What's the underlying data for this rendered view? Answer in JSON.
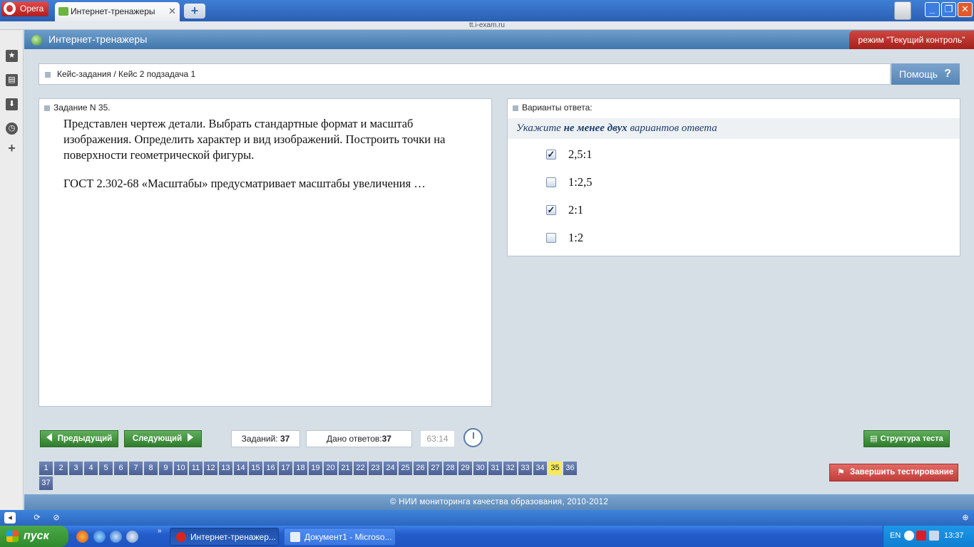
{
  "browser": {
    "opera_label": "Opera",
    "tab_title": "Интернет-тренажеры",
    "url": "tt.i-exam.ru"
  },
  "app": {
    "title": "Интернет-тренажеры",
    "mode": "режим \"Текущий контроль\""
  },
  "breadcrumb": "Кейс-задания / Кейс 2 подзадача 1",
  "help_label": "Помощь",
  "task": {
    "header": "Задание N 35.",
    "description": "Представлен чертеж детали. Выбрать стандартные формат и масштаб изображения. Определить характер и вид изображений. Построить точки на поверхности геометрической фигуры.",
    "question": "ГОСТ 2.302-68 «Масштабы» предусматривает масштабы увеличения …"
  },
  "answers": {
    "header": "Варианты ответа:",
    "instr_pre": "Укажите ",
    "instr_bold": "не менее двух",
    "instr_post": " вариантов ответа",
    "options": [
      {
        "label": "2,5:1",
        "checked": true
      },
      {
        "label": "1:2,5",
        "checked": false
      },
      {
        "label": "2:1",
        "checked": true
      },
      {
        "label": "1:2",
        "checked": false
      }
    ]
  },
  "nav": {
    "prev_label": "Предыдущий",
    "next_label": "Следующий",
    "tasks_label": "Заданий:",
    "tasks_value": "37",
    "answered_label": "Дано ответов:",
    "answered_value": "37",
    "timer": "63:14",
    "structure_label": "Структура теста",
    "finish_label": "Завершить тестирование"
  },
  "question_numbers": [
    "1",
    "2",
    "3",
    "4",
    "5",
    "6",
    "7",
    "8",
    "9",
    "10",
    "11",
    "12",
    "13",
    "14",
    "15",
    "16",
    "17",
    "18",
    "19",
    "20",
    "21",
    "22",
    "23",
    "24",
    "25",
    "26",
    "27",
    "28",
    "29",
    "30",
    "31",
    "32",
    "33",
    "34",
    "35",
    "36",
    "37"
  ],
  "current_question": "35",
  "footer": "© НИИ мониторинга качества образования, 2010-2012",
  "taskbar": {
    "start_label": "пуск",
    "items": [
      "Интернет-тренажер...",
      "Документ1 - Microso..."
    ],
    "lang": "EN",
    "time": "13:37"
  },
  "colors": {
    "header_blue": "#4f84ba",
    "mode_red": "#b8312b",
    "nav_green": "#3e8e3b",
    "finish_red": "#d4524e",
    "current_question_yellow": "#f4ea5a"
  }
}
